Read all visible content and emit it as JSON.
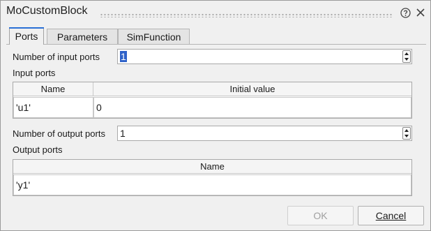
{
  "window": {
    "title": "MoCustomBlock",
    "help_icon": "help-circle-icon",
    "close_icon": "close-icon"
  },
  "tabs": [
    {
      "label": "Ports",
      "active": true
    },
    {
      "label": "Parameters",
      "active": false
    },
    {
      "label": "SimFunction",
      "active": false
    }
  ],
  "ports": {
    "num_inputs_label": "Number of input ports",
    "num_inputs_value": "1",
    "input_ports_label": "Input ports",
    "input_table": {
      "columns": [
        "Name",
        "Initial value"
      ],
      "rows": [
        [
          "'u1'",
          "0"
        ]
      ]
    },
    "num_outputs_label": "Number of output ports",
    "num_outputs_value": "1",
    "output_ports_label": "Output ports",
    "output_table": {
      "columns": [
        "Name"
      ],
      "rows": [
        [
          "'y1'"
        ]
      ]
    }
  },
  "buttons": {
    "ok": {
      "label": "OK",
      "enabled": false
    },
    "cancel": {
      "label": "Cancel",
      "enabled": true
    }
  },
  "colors": {
    "accent": "#2a6fd6",
    "selection": "#2f62c9"
  }
}
